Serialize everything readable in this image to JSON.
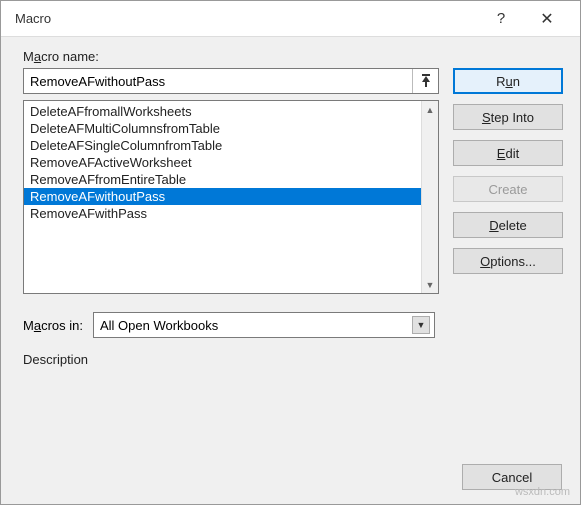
{
  "dialog": {
    "title": "Macro"
  },
  "labels": {
    "macro_name_pre": "M",
    "macro_name_u": "a",
    "macro_name_post": "cro name:",
    "macros_in_pre": "M",
    "macros_in_u": "a",
    "macros_in_post": "cros in:",
    "description": "Description"
  },
  "name_value": "RemoveAFwithoutPass",
  "list": [
    "DeleteAFfromallWorksheets",
    "DeleteAFMultiColumnsfromTable",
    "DeleteAFSingleColumnfromTable",
    "RemoveAFActiveWorksheet",
    "RemoveAFfromEntireTable",
    "RemoveAFwithoutPass",
    "RemoveAFwithPass"
  ],
  "selected_index": 5,
  "macros_in_value": "All Open Workbooks",
  "buttons": {
    "run_pre": "R",
    "run_u": "u",
    "run_post": "n",
    "step_u": "S",
    "step_post": "tep Into",
    "edit_u": "E",
    "edit_post": "dit",
    "create_u": "C",
    "create_post": "reate",
    "delete_u": "D",
    "delete_post": "elete",
    "options_u": "O",
    "options_post": "ptions...",
    "cancel": "Cancel"
  },
  "watermark": "wsxdn.com"
}
